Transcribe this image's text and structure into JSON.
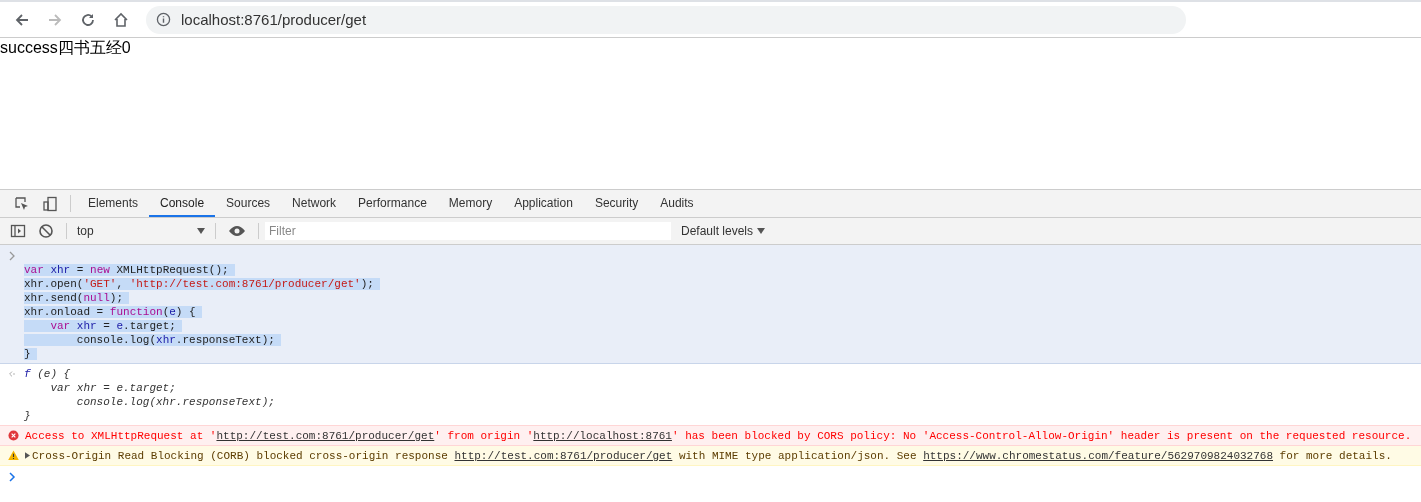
{
  "browser": {
    "url": "localhost:8761/producer/get"
  },
  "page": {
    "text": "success四书五经0"
  },
  "devtools": {
    "tabs": [
      {
        "label": "Elements",
        "selected": false
      },
      {
        "label": "Console",
        "selected": true
      },
      {
        "label": "Sources",
        "selected": false
      },
      {
        "label": "Network",
        "selected": false
      },
      {
        "label": "Performance",
        "selected": false
      },
      {
        "label": "Memory",
        "selected": false
      },
      {
        "label": "Application",
        "selected": false
      },
      {
        "label": "Security",
        "selected": false
      },
      {
        "label": "Audits",
        "selected": false
      }
    ]
  },
  "console_toolbar": {
    "context": "top",
    "filter": {
      "placeholder": "Filter"
    },
    "levels": "Default levels"
  },
  "console": {
    "input": {
      "selected": true,
      "lines": [
        [
          {
            "kind": "keyword",
            "text": "var"
          },
          {
            "kind": "identifier",
            "text": " xhr"
          },
          {
            "kind": "plain",
            "text": " = "
          },
          {
            "kind": "keyword",
            "text": "new"
          },
          {
            "kind": "plain",
            "text": " XMLHttpRequest();"
          }
        ],
        [
          {
            "kind": "plain",
            "text": "xhr.open("
          },
          {
            "kind": "string",
            "text": "'GET'"
          },
          {
            "kind": "plain",
            "text": ", "
          },
          {
            "kind": "string",
            "text": "'http://test.com:8761/producer/get'"
          },
          {
            "kind": "plain",
            "text": ");"
          }
        ],
        [
          {
            "kind": "plain",
            "text": "xhr.send("
          },
          {
            "kind": "keyword",
            "text": "null"
          },
          {
            "kind": "plain",
            "text": ");"
          }
        ],
        [
          {
            "kind": "plain",
            "text": "xhr.onload = "
          },
          {
            "kind": "keyword",
            "text": "function"
          },
          {
            "kind": "plain",
            "text": "("
          },
          {
            "kind": "identifier",
            "text": "e"
          },
          {
            "kind": "plain",
            "text": ") {"
          }
        ],
        [
          {
            "kind": "keyword",
            "text": "    var"
          },
          {
            "kind": "identifier",
            "text": " xhr"
          },
          {
            "kind": "plain",
            "text": " = "
          },
          {
            "kind": "identifier",
            "text": "e"
          },
          {
            "kind": "plain",
            "text": ".target;"
          }
        ],
        [
          {
            "kind": "plain",
            "text": "        console.log("
          },
          {
            "kind": "identifier",
            "text": "xhr"
          },
          {
            "kind": "plain",
            "text": ".responseText);"
          }
        ],
        [
          {
            "kind": "plain",
            "text": "}"
          }
        ]
      ]
    },
    "result": {
      "lines": [
        [
          {
            "kind": "identifier",
            "text": "f"
          },
          {
            "kind": "plain",
            "text": " (e) {"
          }
        ],
        [
          {
            "kind": "plain",
            "text": "    var xhr = e.target;"
          }
        ],
        [
          {
            "kind": "plain",
            "text": "        console.log(xhr.responseText);"
          }
        ],
        [
          {
            "kind": "plain",
            "text": "}"
          }
        ]
      ]
    },
    "messages": [
      {
        "kind": "error",
        "expandable": false,
        "parts": [
          {
            "kind": "text",
            "text": "Access to XMLHttpRequest at '"
          },
          {
            "kind": "link",
            "text": "http://test.com:8761/producer/get"
          },
          {
            "kind": "text",
            "text": "' from origin '"
          },
          {
            "kind": "link",
            "text": "http://localhost:8761"
          },
          {
            "kind": "text",
            "text": "' has been blocked by CORS policy: No 'Access-Control-Allow-Origin' header is present on the requested resource."
          }
        ]
      },
      {
        "kind": "warning",
        "expandable": true,
        "parts": [
          {
            "kind": "text",
            "text": "Cross-Origin Read Blocking (CORB) blocked cross-origin response "
          },
          {
            "kind": "link",
            "text": "http://test.com:8761/producer/get"
          },
          {
            "kind": "text",
            "text": " with MIME type application/json. See "
          },
          {
            "kind": "link",
            "text": "https://www.chromestatus.com/feature/5629709824032768"
          },
          {
            "kind": "text",
            "text": " for more details."
          }
        ]
      }
    ]
  }
}
